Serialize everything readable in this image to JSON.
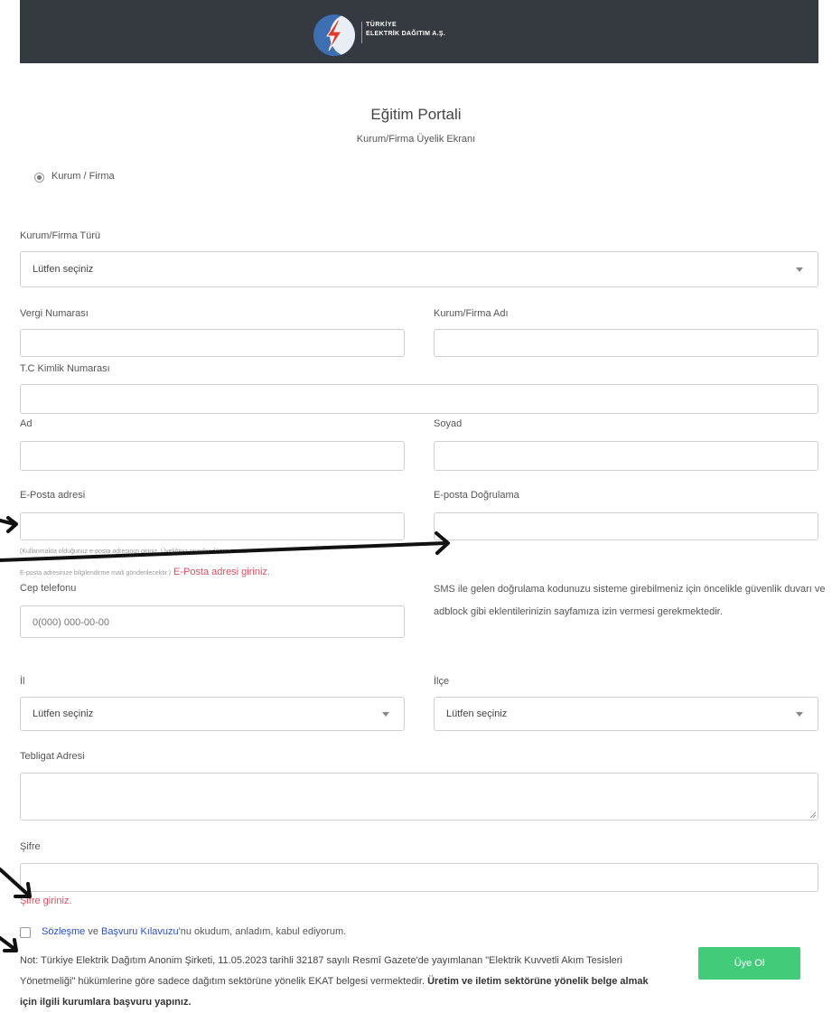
{
  "header": {
    "brand_line1": "TÜRKİYE",
    "brand_line2": "ELEKTRİK DAĞITIM A.Ş."
  },
  "page": {
    "title": "Eğitim Portali",
    "subtitle": "Kurum/Firma Üyelik Ekranı"
  },
  "membership_type": {
    "option_label": "Kurum / Firma",
    "selected": true
  },
  "form": {
    "org_type": {
      "label": "Kurum/Firma Türü",
      "value": "Lütfen seçiniz"
    },
    "tax_number": {
      "label": "Vergi Numarası",
      "value": ""
    },
    "org_name": {
      "label": "Kurum/Firma Adı",
      "value": ""
    },
    "tc_number": {
      "label": "T.C Kimlik Numarası",
      "value": ""
    },
    "first_name": {
      "label": "Ad",
      "value": ""
    },
    "last_name": {
      "label": "Soyad",
      "value": ""
    },
    "email": {
      "label": "E-Posta adresi",
      "value": "",
      "hint_line1": "(Kullanmakta olduğunuz e-posta adresinizi giriniz. Üyeliğiniz onaylandıktan sonra",
      "hint_line2": "E-posta adresinize bilgilendirme maili gönderilecektir.)",
      "error": "E-Posta adresi giriniz."
    },
    "email_confirm": {
      "label": "E-posta Doğrulama",
      "value": ""
    },
    "phone": {
      "label": "Cep telefonu",
      "placeholder": "0(000) 000-00-00"
    },
    "sms_notice": "SMS ile gelen doğrulama kodunuzu sisteme girebilmeniz için öncelikle güvenlik duvarı ve adblock gibi eklentilerinizin sayfamıza izin vermesi gerekmektedir.",
    "city": {
      "label": "İl",
      "value": "Lütfen seçiniz"
    },
    "district": {
      "label": "İlçe",
      "value": "Lütfen seçiniz"
    },
    "address": {
      "label": "Tebligat Adresi",
      "value": ""
    },
    "password": {
      "label": "Şifre",
      "value": "",
      "error": "Şifre giriniz."
    }
  },
  "agreement": {
    "checked": false,
    "link1": "Sözleşme",
    "conj": " ve ",
    "link2": "Başvuru Kılavuzu",
    "rest": "'nu okudum, anladım, kabul ediyorum."
  },
  "note": {
    "text": "Not: Türkiye Elektrik Dağıtım Anonim Şirketi, 11.05.2023 tarihli 32187 sayılı Resmî Gazete'de yayımlanan \"Elektrik Kuvvetli Akım Tesisleri Yönetmeliği\" hükümlerine göre sadece dağıtım sektörüne yönelik EKAT belgesi vermektedir. ",
    "bold": "Üretim ve iletim sektörüne yönelik belge almak için ilgili kurumlara başvuru yapınız."
  },
  "submit_label": "Üye Ol",
  "colors": {
    "header_bg": "#343a40",
    "submit_bg": "#42cc7a",
    "error": "#e64a62",
    "link": "#2a4fc7"
  }
}
